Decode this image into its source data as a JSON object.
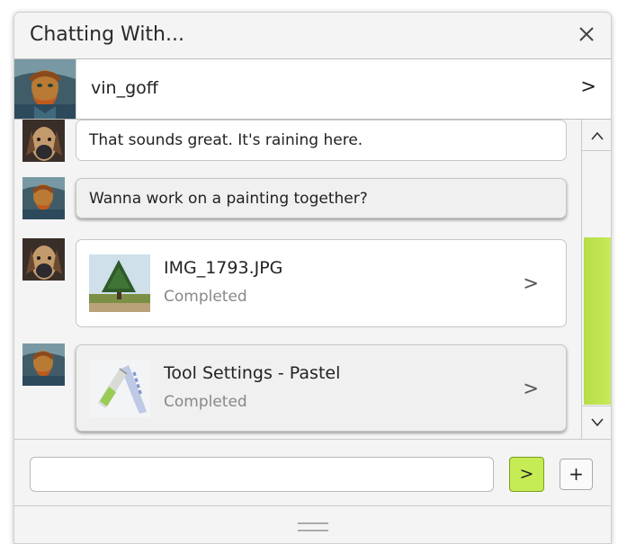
{
  "window": {
    "title": "Chatting With...",
    "close_icon": "close-icon"
  },
  "contact": {
    "name": "vin_goff",
    "arrow": ">"
  },
  "messages": [
    {
      "sender": "other",
      "text": "That sounds great. It's raining here."
    },
    {
      "sender": "me",
      "text": "Wanna work on a painting together?"
    },
    {
      "sender": "other",
      "type": "file",
      "name": "IMG_1793.JPG",
      "status": "Completed",
      "arrow": ">"
    },
    {
      "sender": "me",
      "type": "file",
      "name": "Tool Settings - Pastel",
      "status": "Completed",
      "arrow": ">"
    }
  ],
  "scrollbar": {
    "up": "^",
    "down": "v",
    "position": 0.85
  },
  "input": {
    "value": "",
    "placeholder": ""
  },
  "buttons": {
    "send": ">",
    "add": "+"
  },
  "colors": {
    "accent": "#c6ec55",
    "scroll_thumb": "#b8df46"
  }
}
